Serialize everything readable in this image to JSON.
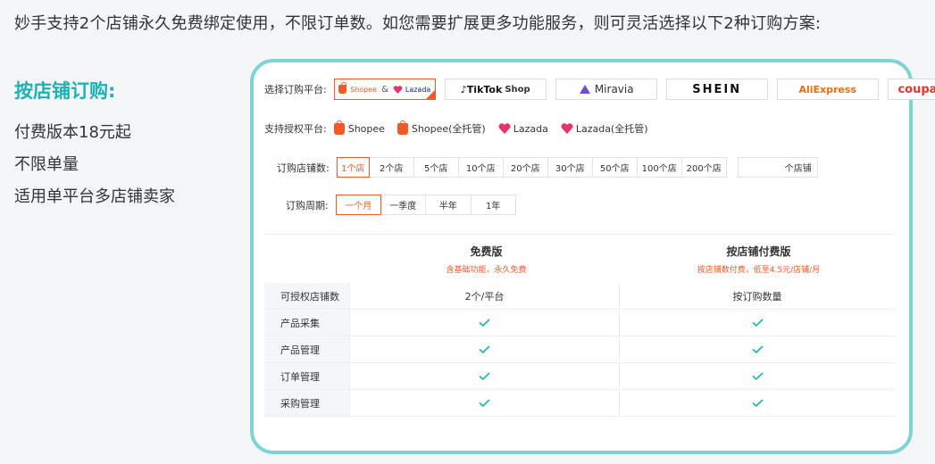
{
  "intro": "妙手支持2个店铺永久免费绑定使用，不限订单数。如您需要扩展更多功能服务，则可灵活选择以下2种订购方案:",
  "plan": {
    "heading": "按店铺订购:",
    "features": [
      "付费版本18元起",
      "不限单量",
      "适用单平台多店铺卖家"
    ]
  },
  "colors": {
    "accent": "#1db1b4",
    "orange": "#f05a28",
    "border": "#7fd3d3"
  },
  "platform_row": {
    "label": "选择订购平台:",
    "options": [
      {
        "shopee": "Shopee",
        "amp": "&",
        "lazada": "Lazada",
        "selected": true
      },
      {
        "brand": "TikTok",
        "suffix": "Shop",
        "icon": "tiktok-icon"
      },
      {
        "text": "Miravia",
        "icon": "miravia-icon"
      },
      {
        "text": "SHEIN"
      },
      {
        "text": "AliExpress"
      },
      {
        "text": "coupang"
      }
    ]
  },
  "auth_row": {
    "label": "支持授权平台:",
    "items": [
      {
        "text": "Shopee",
        "icon": "shopee-bag-icon"
      },
      {
        "text": "Shopee(全托管)",
        "icon": "shopee-bag-icon"
      },
      {
        "text": "Lazada",
        "icon": "lazada-heart-icon"
      },
      {
        "text": "Lazada(全托管)",
        "icon": "lazada-heart-icon"
      }
    ]
  },
  "shops_row": {
    "label": "订购店铺数:",
    "options": [
      "1个店",
      "2个店",
      "5个店",
      "10个店",
      "20个店",
      "30个店",
      "50个店",
      "100个店",
      "200个店"
    ],
    "selected_index": 0,
    "custom_suffix": "个店铺"
  },
  "period_row": {
    "label": "订购周期:",
    "options": [
      "一个月",
      "一季度",
      "半年",
      "1年"
    ],
    "selected_index": 0
  },
  "table": {
    "columns": [
      {
        "name": "免费版",
        "sub": "含基础功能，永久免费"
      },
      {
        "name": "按店铺付费版",
        "sub": "按店铺数付费，低至4.5元/店铺/月"
      }
    ],
    "rows": [
      {
        "label": "可授权店铺数",
        "free": "2个/平台",
        "paid": "按订购数量"
      },
      {
        "label": "产品采集",
        "free": true,
        "paid": true
      },
      {
        "label": "产品管理",
        "free": true,
        "paid": true
      },
      {
        "label": "订单管理",
        "free": true,
        "paid": true
      },
      {
        "label": "采购管理",
        "free": true,
        "paid": true
      }
    ]
  }
}
